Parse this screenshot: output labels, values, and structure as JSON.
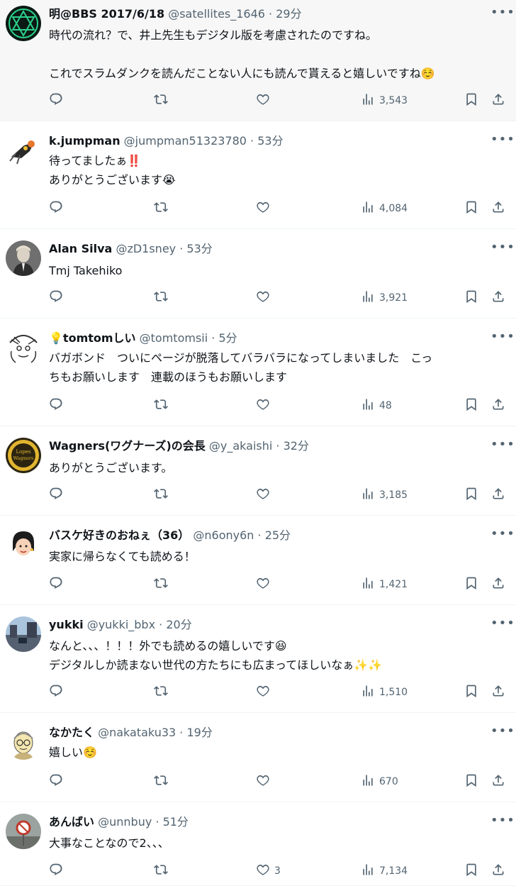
{
  "tweets": [
    {
      "name": "明@BBS 2017/6/18",
      "handle": "@satellites_1646",
      "time": "29分",
      "lines": [
        "時代の流れ？で、井上先生もデジタル版を考慮されたのですね。",
        "",
        "これでスラムダンクを読んだことない人にも読んで貰えると嬉しいですね☺️"
      ],
      "likes": "",
      "views": "3,543",
      "avatar_icon": "hexagram-avatar"
    },
    {
      "name": "k.jumpman",
      "handle": "@jumpman51323780",
      "time": "53分",
      "lines": [
        "待ってましたぁ‼️",
        "ありがとうございます😭"
      ],
      "likes": "",
      "views": "4,084",
      "avatar_icon": "bird-avatar"
    },
    {
      "name": "Alan Silva",
      "handle": "@zD1sney",
      "time": "53分",
      "lines": [
        "Tmj Takehiko"
      ],
      "likes": "",
      "views": "3,921",
      "avatar_icon": "portrait-avatar"
    },
    {
      "name": "💡tomtomしい",
      "handle": "@tomtomsii",
      "time": "5分",
      "lines": [
        "バガボンド　ついにページが脱落してバラバラになってしまいました　こっ",
        "ちもお願いします　連載のほうもお願いします"
      ],
      "likes": "",
      "views": "48",
      "avatar_icon": "sketch-face-avatar"
    },
    {
      "name": "Wagners(ワグナーズ)の会長",
      "handle": "@y_akaishi",
      "time": "32分",
      "lines": [
        "ありがとうございます。"
      ],
      "likes": "",
      "views": "3,185",
      "avatar_icon": "wagners-logo-avatar"
    },
    {
      "name": "バスケ好きのおねぇ（36）",
      "handle": "@n6ony6n",
      "time": "25分",
      "lines": [
        "実家に帰らなくても読める！"
      ],
      "likes": "",
      "views": "1,421",
      "avatar_icon": "cartoon-face-avatar"
    },
    {
      "name": "yukki",
      "handle": "@yukki_bbx",
      "time": "20分",
      "lines": [
        "なんと、、、！！！外でも読めるの嬉しいです😆",
        "デジタルしか読まない世代の方たちにも広まってほしいなぁ✨✨"
      ],
      "likes": "",
      "views": "1,510",
      "avatar_icon": "street-photo-avatar"
    },
    {
      "name": "なかたく",
      "handle": "@nakataku33",
      "time": "19分",
      "lines": [
        "嬉しい☺️"
      ],
      "likes": "",
      "views": "670",
      "avatar_icon": "glasses-man-avatar"
    },
    {
      "name": "あんばい",
      "handle": "@unnbuy",
      "time": "51分",
      "lines": [
        "大事なことなので2、、、"
      ],
      "likes": "3",
      "views": "7,134",
      "avatar_icon": "sign-photo-avatar"
    }
  ],
  "colors": {
    "text": "#0f1419",
    "muted": "#536471",
    "border": "#eff3f4",
    "highlight_bg": "#f7f7f7"
  }
}
